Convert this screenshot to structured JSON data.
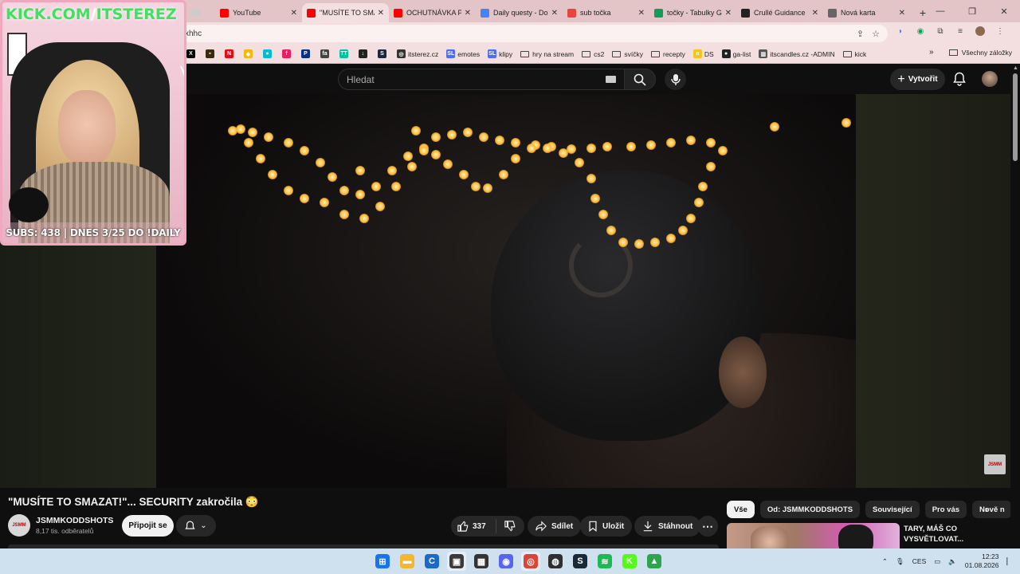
{
  "tabs": [
    {
      "title": "YouTube",
      "favicon": "youtube-icon",
      "color": "#ff0000",
      "active": false
    },
    {
      "title": "\"MUSÍTE TO SMAZAT",
      "favicon": "youtube-icon",
      "color": "#ff0000",
      "active": true
    },
    {
      "title": "OCHUTNÁVKA P",
      "favicon": "youtube-icon",
      "color": "#ff0000",
      "active": false
    },
    {
      "title": "Daily questy - Do",
      "favicon": "google-docs-icon",
      "color": "#4285f4",
      "active": false
    },
    {
      "title": "sub točka",
      "favicon": "slides-icon",
      "color": "#e8453c",
      "active": false
    },
    {
      "title": "točky - Tabulky G",
      "favicon": "sheets-icon",
      "color": "#0f9d58",
      "active": false
    },
    {
      "title": "Crullé Guidance",
      "favicon": "notion-icon",
      "color": "#222222",
      "active": false
    },
    {
      "title": "Nová karta",
      "favicon": "chrome-icon",
      "color": "#666666",
      "active": false
    }
  ],
  "address": {
    "url": "xhhc"
  },
  "bookmarks": [
    {
      "label": "",
      "icon": "x-icon",
      "color": "#000000",
      "glyph": "X"
    },
    {
      "label": "",
      "icon": "app-icon",
      "color": "#3a2a10",
      "glyph": "▪"
    },
    {
      "label": "",
      "icon": "netflix-icon",
      "color": "#e50914",
      "glyph": "N"
    },
    {
      "label": "",
      "icon": "binance-icon",
      "color": "#f0b90b",
      "glyph": "◆"
    },
    {
      "label": "",
      "icon": "cyan-icon",
      "color": "#00bcd4",
      "glyph": "●"
    },
    {
      "label": "",
      "icon": "fiverr-icon",
      "color": "#e91e63",
      "glyph": "f"
    },
    {
      "label": "",
      "icon": "paypal-icon",
      "color": "#003087",
      "glyph": "P"
    },
    {
      "label": "",
      "icon": "faceit-icon",
      "color": "#444444",
      "glyph": "fa"
    },
    {
      "label": "",
      "icon": "tiktok-icon",
      "color": "#00c2a0",
      "glyph": "TT"
    },
    {
      "label": "",
      "icon": "download-icon",
      "color": "#222222",
      "glyph": "↓"
    },
    {
      "label": "",
      "icon": "steam-icon",
      "color": "#1b2838",
      "glyph": "S"
    },
    {
      "label": "itsterez.cz",
      "icon": "globe-icon",
      "color": "#333333",
      "glyph": "◎"
    },
    {
      "label": "emotes",
      "icon": "sl-icon",
      "color": "#4a6cf7",
      "glyph": "SL"
    },
    {
      "label": "klipy",
      "icon": "sl-icon",
      "color": "#4a6cf7",
      "glyph": "SL"
    },
    {
      "label": "hry na stream",
      "icon": "folder-icon"
    },
    {
      "label": "cs2",
      "icon": "folder-icon"
    },
    {
      "label": "svíčky",
      "icon": "folder-icon"
    },
    {
      "label": "recepty",
      "icon": "folder-icon"
    },
    {
      "label": "DS",
      "icon": "ds-icon",
      "color": "#f5c518",
      "glyph": "ıı"
    },
    {
      "label": "ga-list",
      "icon": "github-icon",
      "color": "#222222",
      "glyph": "●"
    },
    {
      "label": "itscandles.cz -ADMIN",
      "icon": "admin-icon",
      "color": "#555555",
      "glyph": "▥"
    },
    {
      "label": "kick",
      "icon": "folder-icon"
    }
  ],
  "all_bookmarks": "Všechny záložky",
  "search": {
    "placeholder": "Hledat"
  },
  "header": {
    "create_label": "Vytvořit"
  },
  "overlay": {
    "site": "KICK.COM",
    "slash": "/",
    "handle": "ITSTEREZ",
    "subs_text": "SUBS: 438 | DNES 3/25 DO !DAILY"
  },
  "video": {
    "title": "\"MUSÍTE TO SMAZAT!\"... SECURITY zakročila 😳",
    "channel": "JSMMKODDSHOTS",
    "channel_subs": "8,17 tis. odběratelů",
    "subscribe_label": "Připojit se",
    "likes": "337",
    "share_label": "Sdílet",
    "save_label": "Uložit",
    "download_label": "Stáhnout"
  },
  "chips": [
    "Vše",
    "Od: JSMMKODDSHOTS",
    "Související",
    "Pro vás",
    "Nově n"
  ],
  "recommendation": {
    "title": "TARY, MÁŠ CO VYSVĚTLOVAT..."
  },
  "taskbar": {
    "apps": [
      {
        "name": "windows-start-icon",
        "color": "#1a73e8",
        "glyph": "⊞"
      },
      {
        "name": "file-explorer-icon",
        "color": "#f2b731",
        "glyph": "▬"
      },
      {
        "name": "ccleaner-icon",
        "color": "#1b6ac9",
        "glyph": "C"
      },
      {
        "name": "terminal-icon",
        "color": "#3a3a3a",
        "glyph": "▣"
      },
      {
        "name": "minecraft-icon",
        "color": "#333333",
        "glyph": "▦"
      },
      {
        "name": "discord-icon",
        "color": "#5865f2",
        "glyph": "◉"
      },
      {
        "name": "chrome-icon",
        "color": "#db4437",
        "glyph": "◎"
      },
      {
        "name": "obs-icon",
        "color": "#302e31",
        "glyph": "◍"
      },
      {
        "name": "steam-icon",
        "color": "#1b2838",
        "glyph": "S"
      },
      {
        "name": "spotify-icon",
        "color": "#1db954",
        "glyph": "≋"
      },
      {
        "name": "kick-icon",
        "color": "#53fc18",
        "glyph": "K"
      },
      {
        "name": "drive-icon",
        "color": "#2da44e",
        "glyph": "▲"
      }
    ],
    "language": "CES",
    "time": "12:23",
    "date": "01.08.2026"
  }
}
